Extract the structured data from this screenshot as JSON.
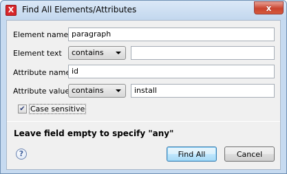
{
  "window": {
    "title": "Find All Elements/Attributes",
    "app_icon_glyph": "X",
    "close_glyph": "x"
  },
  "fields": {
    "element_name_label": "Element name",
    "element_name_value": "paragraph",
    "element_text_label": "Element text",
    "element_text_mode": "contains",
    "element_text_value": "",
    "attribute_name_label": "Attribute name",
    "attribute_name_value": "id",
    "attribute_value_label": "Attribute value",
    "attribute_value_mode": "contains",
    "attribute_value_value": "install"
  },
  "options": {
    "case_sensitive_label": "Case sensitive",
    "case_sensitive_checked": true,
    "check_glyph": "✔"
  },
  "note": "Leave field empty to specify \"any\"",
  "help_glyph": "?",
  "buttons": {
    "find_all": "Find All",
    "cancel": "Cancel"
  }
}
